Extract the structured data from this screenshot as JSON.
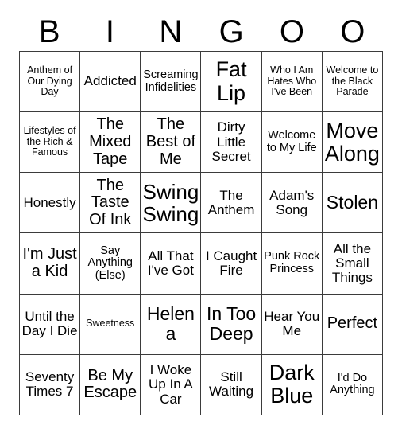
{
  "card": {
    "title": "BINGOO",
    "columns": 6,
    "rows": 6,
    "border_color": "#3b3b3b",
    "background_color": "#ffffff",
    "text_color": "#000000",
    "header_letters": [
      "B",
      "I",
      "N",
      "G",
      "O",
      "O"
    ],
    "cells": [
      [
        {
          "text": "Anthem of Our Dying Day",
          "size": "xs"
        },
        {
          "text": "Addicted",
          "size": "md"
        },
        {
          "text": "Screaming Infidelities",
          "size": "sm"
        },
        {
          "text": "Fat Lip",
          "size": "xxl"
        },
        {
          "text": "Who I Am Hates Who I've Been",
          "size": "xs"
        },
        {
          "text": "Welcome to the Black Parade",
          "size": "xs"
        }
      ],
      [
        {
          "text": "Lifestyles of the Rich & Famous",
          "size": "xs"
        },
        {
          "text": "The Mixed Tape",
          "size": "lg"
        },
        {
          "text": "The Best of Me",
          "size": "lg"
        },
        {
          "text": "Dirty Little Secret",
          "size": "md"
        },
        {
          "text": "Welcome to My Life",
          "size": "sm"
        },
        {
          "text": "Move Along",
          "size": "xxl"
        }
      ],
      [
        {
          "text": "Honestly",
          "size": "md"
        },
        {
          "text": "The Taste Of Ink",
          "size": "lg"
        },
        {
          "text": "Swing Swing",
          "size": "xxl"
        },
        {
          "text": "The Anthem",
          "size": "md"
        },
        {
          "text": "Adam's Song",
          "size": "md"
        },
        {
          "text": "Stolen",
          "size": "xl"
        }
      ],
      [
        {
          "text": "I'm Just a Kid",
          "size": "lg"
        },
        {
          "text": "Say Anything (Else)",
          "size": "sm"
        },
        {
          "text": "All That I've Got",
          "size": "md"
        },
        {
          "text": "I Caught Fire",
          "size": "md"
        },
        {
          "text": "Punk Rock Princess",
          "size": "sm"
        },
        {
          "text": "All the Small Things",
          "size": "md"
        }
      ],
      [
        {
          "text": "Until the Day I Die",
          "size": "md"
        },
        {
          "text": "Sweetness",
          "size": "xs"
        },
        {
          "text": "Helena",
          "size": "xl"
        },
        {
          "text": "In Too Deep",
          "size": "xl"
        },
        {
          "text": "Hear You Me",
          "size": "md"
        },
        {
          "text": "Perfect",
          "size": "lg"
        }
      ],
      [
        {
          "text": "Seventy Times 7",
          "size": "md"
        },
        {
          "text": "Be My Escape",
          "size": "lg"
        },
        {
          "text": "I Woke Up In A Car",
          "size": "md"
        },
        {
          "text": "Still Waiting",
          "size": "md"
        },
        {
          "text": "Dark Blue",
          "size": "xxl"
        },
        {
          "text": "I'd Do Anything",
          "size": "sm"
        }
      ]
    ]
  }
}
